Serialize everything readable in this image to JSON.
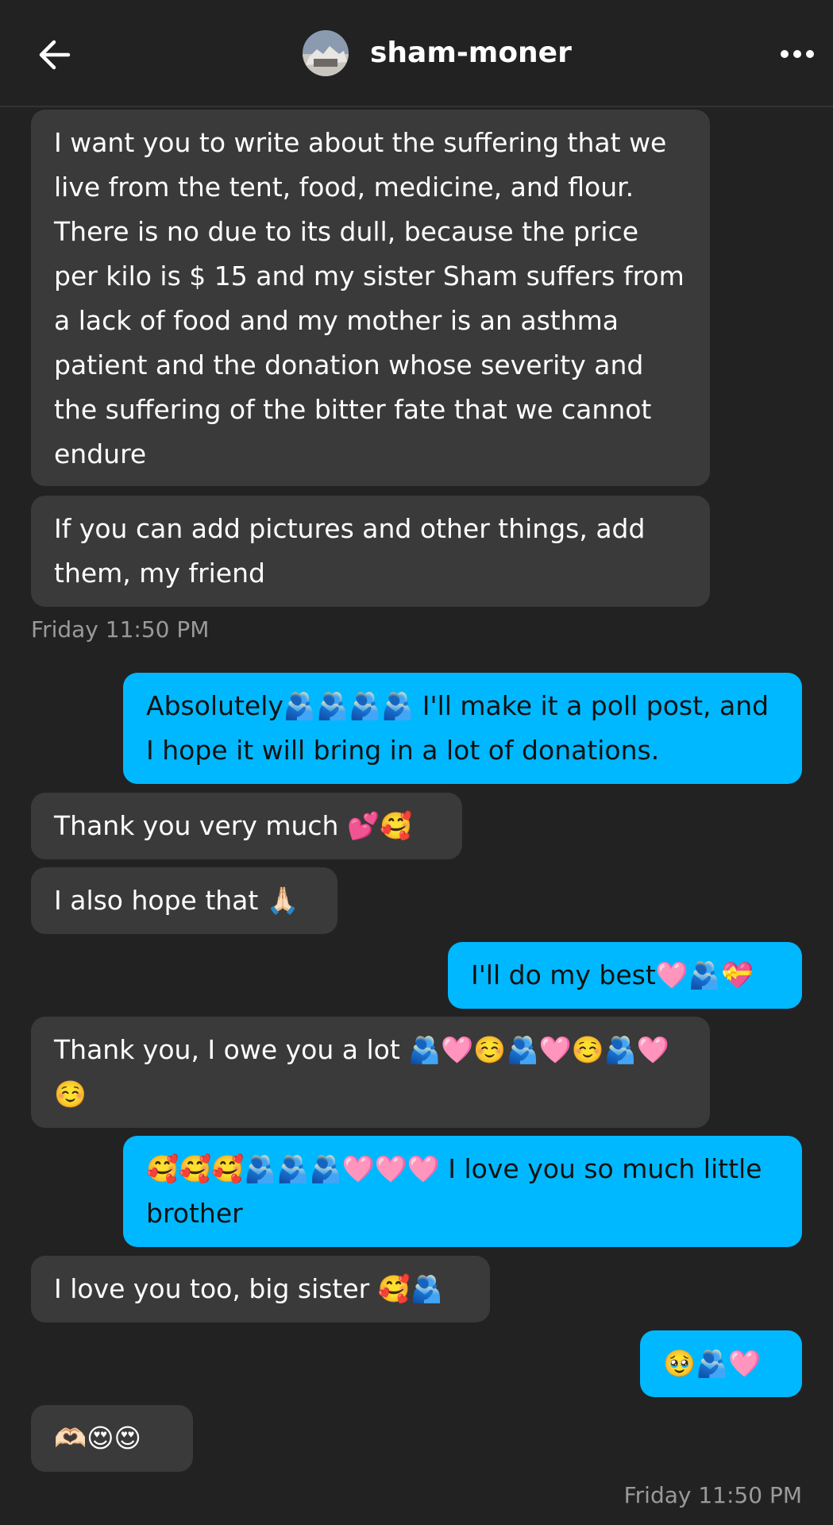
{
  "header": {
    "title": "sham-moner",
    "back_icon": "arrow-left-icon",
    "more_icon": "more-horizontal-icon"
  },
  "colors": {
    "background": "#222222",
    "incoming_bubble": "#3a3a3a",
    "outgoing_bubble": "#00b8ff",
    "timestamp": "#9a9a9a"
  },
  "messages": [
    {
      "from": "them",
      "text": "I want you to write about the suffering that we live from the tent, food, medicine, and flour. There is no due to its dull, because the price per kilo is $ 15 and my sister Sham suffers from a lack of food and my mother is an asthma patient and the donation whose severity and the suffering of the bitter fate that we cannot endure"
    },
    {
      "from": "them",
      "text": "If you can add pictures and other things, add them, my friend"
    },
    {
      "from": "me",
      "text": "Absolutely🫂🫂🫂🫂 I'll make it a poll post, and I hope it will bring in a lot of donations."
    },
    {
      "from": "them",
      "text": "Thank you very much 💕🥰"
    },
    {
      "from": "them",
      "text": "I also hope that 🙏🏻"
    },
    {
      "from": "me",
      "text": "I'll do my best🩷🫂💝"
    },
    {
      "from": "them",
      "text": "Thank you, I owe you a lot 🫂🩷☺️🫂🩷☺️🫂🩷☺️"
    },
    {
      "from": "me",
      "text": "🥰🥰🥰🫂🫂🫂🩷🩷🩷 I love you so much little brother"
    },
    {
      "from": "them",
      "text": "I love you too, big sister 🥰🫂"
    },
    {
      "from": "me",
      "text": "🥹🫂🩷"
    },
    {
      "from": "them",
      "text": "🫶🏻😍😍"
    }
  ],
  "timestamps": [
    "Friday 11:50 PM",
    "Friday 11:50 PM"
  ]
}
